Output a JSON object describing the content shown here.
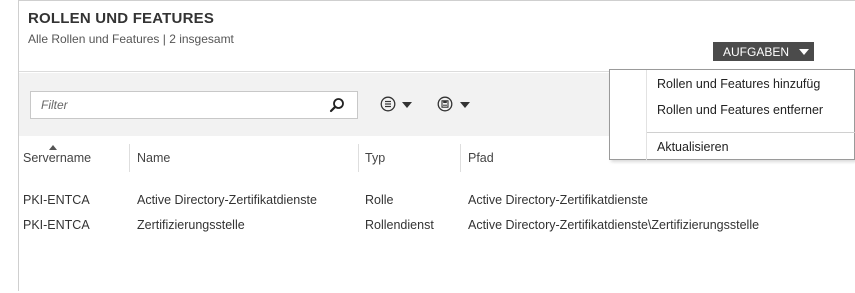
{
  "header": {
    "title": "ROLLEN UND FEATURES",
    "subtitle": "Alle Rollen und Features | 2 insgesamt",
    "tasks_label": "AUFGABEN"
  },
  "toolbar": {
    "filter_placeholder": "Filter",
    "icons": [
      "search-icon",
      "list-view-icon",
      "save-icon"
    ]
  },
  "table": {
    "columns": [
      "Servername",
      "Name",
      "Typ",
      "Pfad"
    ],
    "rows": [
      {
        "server": "PKI-ENTCA",
        "name": "Active Directory-Zertifikatdienste",
        "type": "Rolle",
        "path": "Active Directory-Zertifikatdienste"
      },
      {
        "server": "PKI-ENTCA",
        "name": "Zertifizierungsstelle",
        "type": "Rollendienst",
        "path": "Active Directory-Zertifikatdienste\\Zertifizierungsstelle"
      }
    ]
  },
  "tasks_menu": {
    "items": [
      "Rollen und Features hinzufüg",
      "Rollen und Features entferner",
      "Aktualisieren"
    ]
  },
  "colors": {
    "tasks_button": "#4b4b4b",
    "toolbar_bg": "#f2f2f2"
  }
}
